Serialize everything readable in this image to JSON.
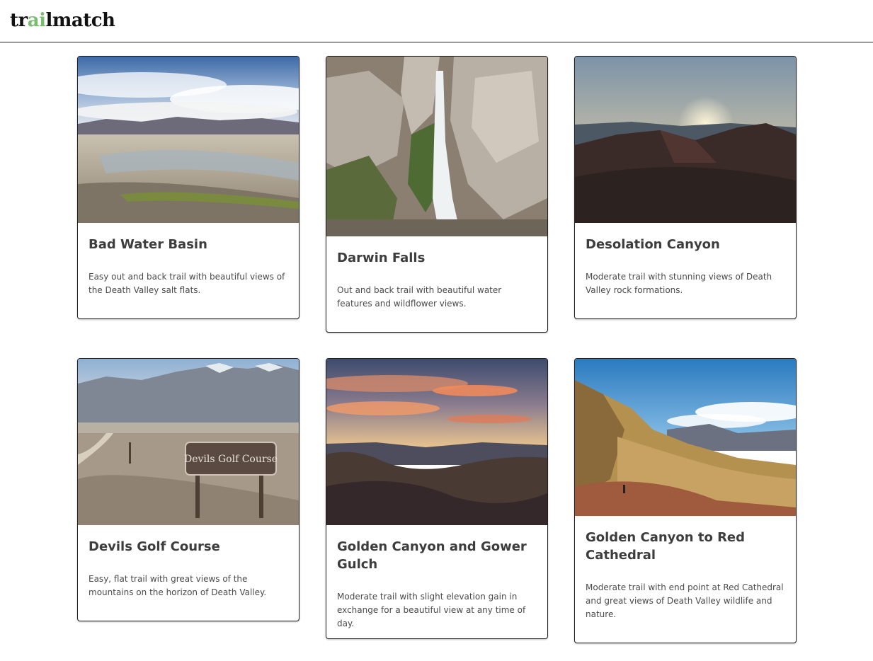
{
  "header": {
    "logo_prefix": "tr",
    "logo_accent": "ai",
    "logo_suffix": "lmatch",
    "accent_color": "#7dbb72"
  },
  "trails": [
    {
      "title": "Bad Water Basin",
      "description": "Easy out and back trail with beautiful views of the Death Valley salt flats.",
      "image": "salt-flats-photo"
    },
    {
      "title": "Darwin Falls",
      "description": "Out and back trail with beautiful water features and wildflower views.",
      "image": "waterfall-photo"
    },
    {
      "title": "Desolation Canyon",
      "description": "Moderate trail with stunning views of Death Valley rock formations.",
      "image": "desert-sunrise-photo"
    },
    {
      "title": "Devils Golf Course",
      "description": "Easy, flat trail with great views of the mountains on the horizon of Death Valley.",
      "image": "devils-golf-course-sign-photo",
      "sign_text": "Devils Golf Course"
    },
    {
      "title": "Golden Canyon and Gower Gulch",
      "description": "Moderate trail with slight elevation gain in exchange for a beautiful view at any time of day.",
      "image": "badlands-sunset-photo"
    },
    {
      "title": "Golden Canyon to Red Cathedral",
      "description": "Moderate trail with end point at Red Cathedral and great views of Death Valley wildlife and nature.",
      "image": "golden-canyon-hiker-photo"
    }
  ]
}
